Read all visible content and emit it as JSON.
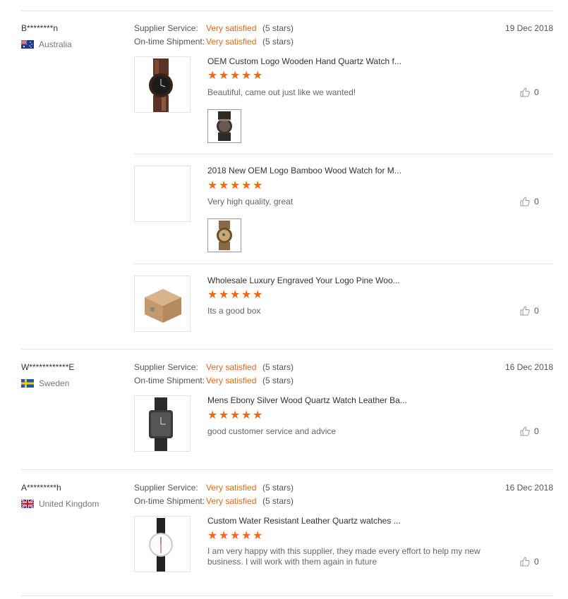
{
  "labels": {
    "supplier_service": "Supplier Service:",
    "ontime_shipment": "On-time Shipment:"
  },
  "reviews": [
    {
      "buyer": "B********n",
      "country": "Australia",
      "date": "19 Dec 2018",
      "supplier_rating": "Very satisfied",
      "supplier_stars": "(5 stars)",
      "shipment_rating": "Very satisfied",
      "shipment_stars": "(5 stars)",
      "items": [
        {
          "product": "OEM Custom Logo Wooden Hand Quartz Watch f...",
          "rating": 5,
          "comment": "Beautiful, came out just like we wanted!",
          "likes": "0"
        },
        {
          "product": "2018 New OEM Logo Bamboo Wood Watch for M...",
          "rating": 5,
          "comment": "Very high quality, great",
          "likes": "0"
        },
        {
          "product": "Wholesale Luxury Engraved Your Logo Pine Woo...",
          "rating": 5,
          "comment": "Its a good box",
          "likes": "0"
        }
      ]
    },
    {
      "buyer": "W************E",
      "country": "Sweden",
      "date": "16 Dec 2018",
      "supplier_rating": "Very satisfied",
      "supplier_stars": "(5 stars)",
      "shipment_rating": "Very satisfied",
      "shipment_stars": "(5 stars)",
      "items": [
        {
          "product": "Mens Ebony Silver Wood Quartz Watch Leather Ba...",
          "rating": 5,
          "comment": "good customer service and advice",
          "likes": "0"
        }
      ]
    },
    {
      "buyer": "A*********h",
      "country": "United Kingdom",
      "date": "16 Dec 2018",
      "supplier_rating": "Very satisfied",
      "supplier_stars": "(5 stars)",
      "shipment_rating": "Very satisfied",
      "shipment_stars": "(5 stars)",
      "items": [
        {
          "product": "Custom Water Resistant Leather Quartz watches ...",
          "rating": 5,
          "comment": "I am very happy with this supplier, they made every effort to help my new business. I will work with them again in future",
          "likes": "0"
        }
      ]
    }
  ],
  "colors": {
    "accent": "#e8661b",
    "star": "#ee6a15",
    "divider": "#e3e3e3"
  },
  "icons": {
    "like": "thumbs-up-icon",
    "star": "star-icon"
  }
}
